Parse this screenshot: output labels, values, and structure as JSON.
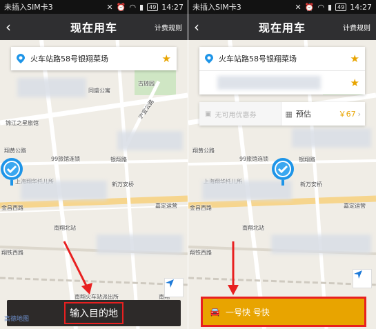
{
  "status": {
    "carrier": "未插入SIM卡3",
    "battery": "49",
    "time": "14:27"
  },
  "header": {
    "title": "现在用车",
    "rules_label": "计费规则"
  },
  "trip": {
    "pickup_address": "火车站路58号银翔菜场"
  },
  "pricing": {
    "coupon_label": "无可用优惠券",
    "estimate_label": "预估",
    "estimate_price": "￥67"
  },
  "map": {
    "labels": {
      "tongle": "同盛公寓",
      "gudu": "古琦园",
      "jinjiang": "锦江之星旅馆",
      "huxuan": "沪宜公路",
      "xianghuang": "翔黄公路",
      "hotel99": "99旅馆连锁",
      "yinxiang": "银翔路",
      "nursery": "上海翔华托儿所",
      "xinwan": "新万安桥",
      "jiading": "嘉定运营",
      "jinchang": "金昌西路",
      "nanxiang_north": "南翔北站",
      "xiangtie": "翔铁西路",
      "station_exit": "南翔火车站派出所",
      "nanx": "南翔",
      "gaode": "高德地图"
    }
  },
  "actions": {
    "destination_label": "输入目的地",
    "express_label": "一号快 号快"
  },
  "colors": {
    "accent": "#e8a400",
    "highlight": "#e82020",
    "header": "#2f2f31",
    "pin": "#1e95e8"
  }
}
